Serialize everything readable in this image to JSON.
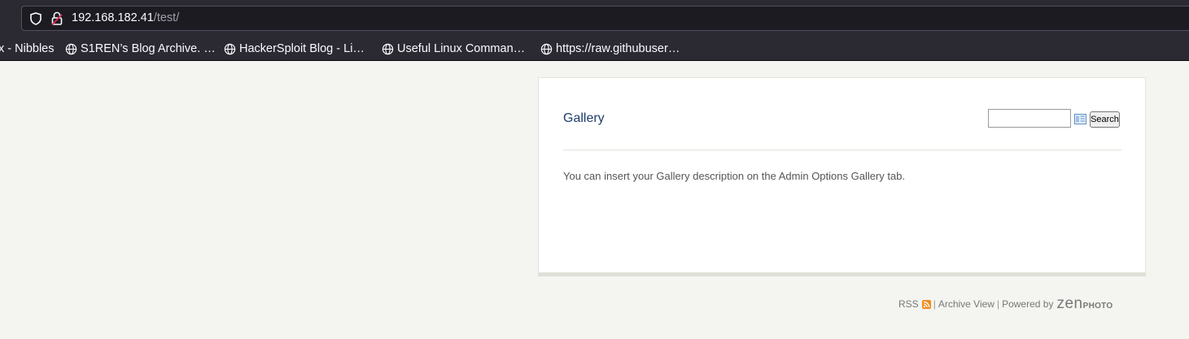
{
  "browser": {
    "url_host": "192.168.182.41",
    "url_path": "/test/",
    "bookmarks": [
      {
        "label": "x - Nibbles",
        "icon": "none"
      },
      {
        "label": "S1REN’s Blog Archive. …",
        "icon": "globe-icon"
      },
      {
        "label": "HackerSploit Blog - Li…",
        "icon": "globe-icon"
      },
      {
        "label": "Useful Linux Comman…",
        "icon": "globe-icon"
      },
      {
        "label": "https://raw.githubuser…",
        "icon": "globe-icon"
      }
    ]
  },
  "gallery": {
    "title": "Gallery",
    "search_value": "",
    "search_button": "Search",
    "description": "You can insert your Gallery description on the Admin Options Gallery tab."
  },
  "footer": {
    "rss": "RSS",
    "separator": "|",
    "archive": "Archive View",
    "powered_by": "Powered by",
    "logo_big": "zen",
    "logo_small": "PHOTO"
  },
  "colors": {
    "chrome_bg": "#2b2a33",
    "page_bg": "#f4f4f1",
    "title_link": "#1e3d6b",
    "rss_orange": "#f28a1b"
  }
}
